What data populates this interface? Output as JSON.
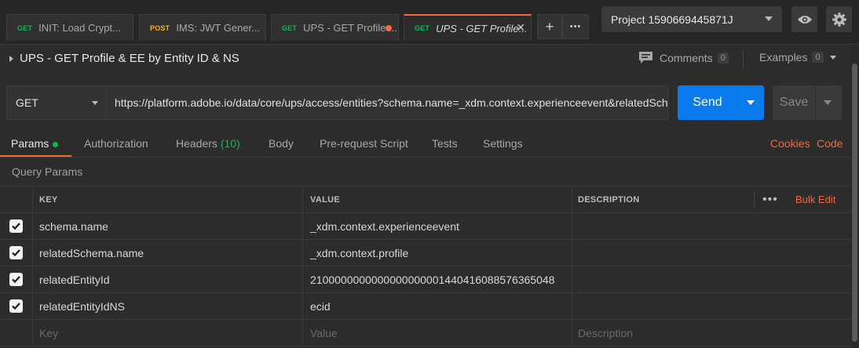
{
  "tabs": [
    {
      "method": "GET",
      "title": "INIT: Load Crypt..."
    },
    {
      "method": "POST",
      "title": "IMS: JWT Gener..."
    },
    {
      "method": "GET",
      "title": "UPS - GET Profile ..."
    },
    {
      "method": "GET",
      "title": "UPS - GET Profile..."
    }
  ],
  "tab_actions": {
    "add": "+",
    "more": "•••"
  },
  "project": {
    "name": "Project 1590669445871J"
  },
  "request": {
    "title": "UPS - GET Profile & EE by Entity ID & NS",
    "comments_label": "Comments",
    "comments_count": "0",
    "examples_label": "Examples",
    "examples_count": "0",
    "method": "GET",
    "url": "https://platform.adobe.io/data/core/ups/access/entities?schema.name=_xdm.context.experienceevent&relatedSchema.name=_xdm.context.profile&relatedEntityId=2100000000000000000001440416088576365048relatedEntityIdNS=ecid",
    "send_label": "Send",
    "save_label": "Save"
  },
  "subtabs": {
    "params": "Params",
    "authorization": "Authorization",
    "headers": "Headers",
    "headers_count": "(10)",
    "body": "Body",
    "prerequest": "Pre-request Script",
    "tests": "Tests",
    "settings": "Settings",
    "cookies": "Cookies",
    "code": "Code"
  },
  "query_params": {
    "section_title": "Query Params",
    "columns": {
      "key": "KEY",
      "value": "VALUE",
      "description": "DESCRIPTION"
    },
    "more": "•••",
    "bulk_edit": "Bulk Edit",
    "rows": [
      {
        "checked": true,
        "key": "schema.name",
        "value": "_xdm.context.experienceevent",
        "description": ""
      },
      {
        "checked": true,
        "key": "relatedSchema.name",
        "value": "_xdm.context.profile",
        "description": ""
      },
      {
        "checked": true,
        "key": "relatedEntityId",
        "value": "2100000000000000000001440416088576365048",
        "description": ""
      },
      {
        "checked": true,
        "key": "relatedEntityIdNS",
        "value": "ecid",
        "description": ""
      }
    ],
    "placeholders": {
      "key": "Key",
      "value": "Value",
      "description": "Description"
    }
  },
  "colors": {
    "accent": "#f26b3a",
    "send": "#097bed",
    "get": "#0cbb52",
    "post": "#ffb400"
  }
}
